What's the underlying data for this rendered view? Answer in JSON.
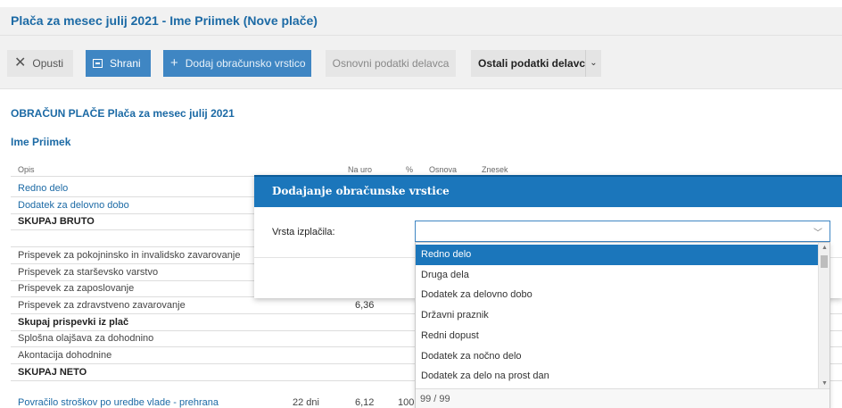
{
  "window": {
    "title": "Plača za mesec julij 2021 - Ime Priimek (Nove plače)"
  },
  "toolbar": {
    "cancel_label": "Opusti",
    "save_label": "Shrani",
    "add_label": "Dodaj obračunsko vrstico",
    "basic_label": "Osnovni podatki delavca",
    "other_label": "Ostali podatki delavca"
  },
  "main": {
    "section_title": "OBRAČUN PLAČE Plača za mesec julij 2021",
    "person": "Ime Priimek",
    "columns": [
      "Opis",
      "Na uro",
      "%",
      "Osnova",
      "Znesek"
    ],
    "rows": [
      {
        "label": "Redno delo",
        "style": "link",
        "n1": "",
        "n2": "",
        "n3": ""
      },
      {
        "label": "Dodatek za delovno dobo",
        "style": "link",
        "n1": "",
        "n2": "",
        "n3": ""
      },
      {
        "label": "SKUPAJ BRUTO",
        "style": "bold",
        "n1": "",
        "n2": "",
        "n3": ""
      },
      {
        "label": "",
        "style": "plain",
        "n1": "",
        "n2": "",
        "n3": ""
      },
      {
        "label": "Prispevek za pokojninsko in invalidsko zavarovanje",
        "style": "plain",
        "n1": "",
        "n2": "",
        "n3": ""
      },
      {
        "label": "Prispevek za starševsko varstvo",
        "style": "plain",
        "n1": "",
        "n2": "",
        "n3": ""
      },
      {
        "label": "Prispevek za zaposlovanje",
        "style": "plain",
        "n1": "",
        "n2": "",
        "n3": ""
      },
      {
        "label": "Prispevek za zdravstveno zavarovanje",
        "style": "plain",
        "n1": "",
        "n2": "6,36",
        "n3": ""
      },
      {
        "label": "Skupaj prispevki iz plač",
        "style": "bold",
        "n1": "",
        "n2": "",
        "n3": ""
      },
      {
        "label": "Splošna olajšava za dohodnino",
        "style": "plain",
        "n1": "",
        "n2": "",
        "n3": ""
      },
      {
        "label": "Akontacija dohodnine",
        "style": "plain",
        "n1": "",
        "n2": "",
        "n3": ""
      },
      {
        "label": "SKUPAJ NETO",
        "style": "bold",
        "n1": "",
        "n2": "",
        "n3": ""
      }
    ],
    "bottom_row": {
      "label": "Povračilo stroškov po uredbe vlade - prehrana",
      "a": "22 dni",
      "b": "6,12",
      "c": "100"
    }
  },
  "dialog": {
    "title": "Dodajanje obračunske vrstice",
    "field_label": "Vrsta izplačila:",
    "field_value": ""
  },
  "dropdown": {
    "options": [
      "Redno delo",
      "Druga dela",
      "Dodatek za delovno dobo",
      "Državni praznik",
      "Redni dopust",
      "Dodatek za nočno delo",
      "Dodatek za delo na prost dan"
    ],
    "selected_index": 0,
    "footer": "99 / 99"
  },
  "colors": {
    "accent": "#1b76bb",
    "link": "#1c6aa5",
    "button_primary": "#3f86c3"
  }
}
